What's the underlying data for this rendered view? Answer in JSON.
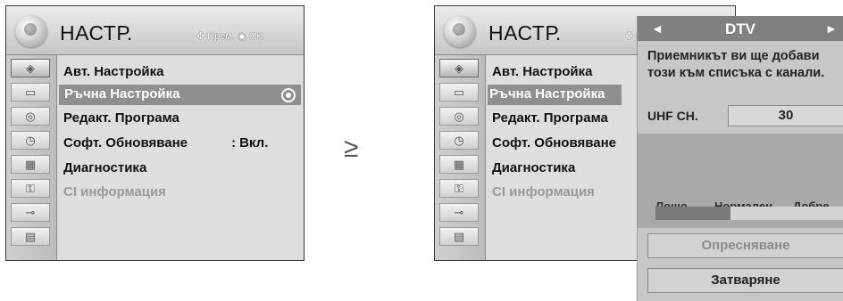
{
  "menu": {
    "title": "НАСТР.",
    "hint": "Прем. ◉ OK",
    "items": [
      {
        "label": "Авт. Настройка",
        "value": ""
      },
      {
        "label": "Ръчна Настройка",
        "value": ""
      },
      {
        "label": "Редакт. Програма",
        "value": ""
      },
      {
        "label": "Софт. Обновяване",
        "value": ": Вкл."
      },
      {
        "label": "Диагностика",
        "value": ""
      },
      {
        "label": "CI информация",
        "value": ""
      }
    ],
    "selected_index": 1
  },
  "arrow": "≥",
  "icons": [
    "antenna-icon",
    "tv-icon",
    "disc-icon",
    "clock-icon",
    "lock-icon",
    "padlock-icon",
    "plug-icon",
    "clapper-icon"
  ],
  "dtv_popup": {
    "title": "DTV",
    "prev": "◄",
    "next": "►",
    "message_line1": "Приемникът ви ще добави",
    "message_line2": "този към списъка с канали.",
    "uhf_label": "UHF CH.",
    "uhf_value": "30",
    "quality_labels": {
      "bad": "Лошо",
      "normal": "Нормален",
      "good": "Добре"
    },
    "signal_level": 0.4,
    "refresh_button": "Опресняване",
    "close_button": "Затваряне"
  }
}
